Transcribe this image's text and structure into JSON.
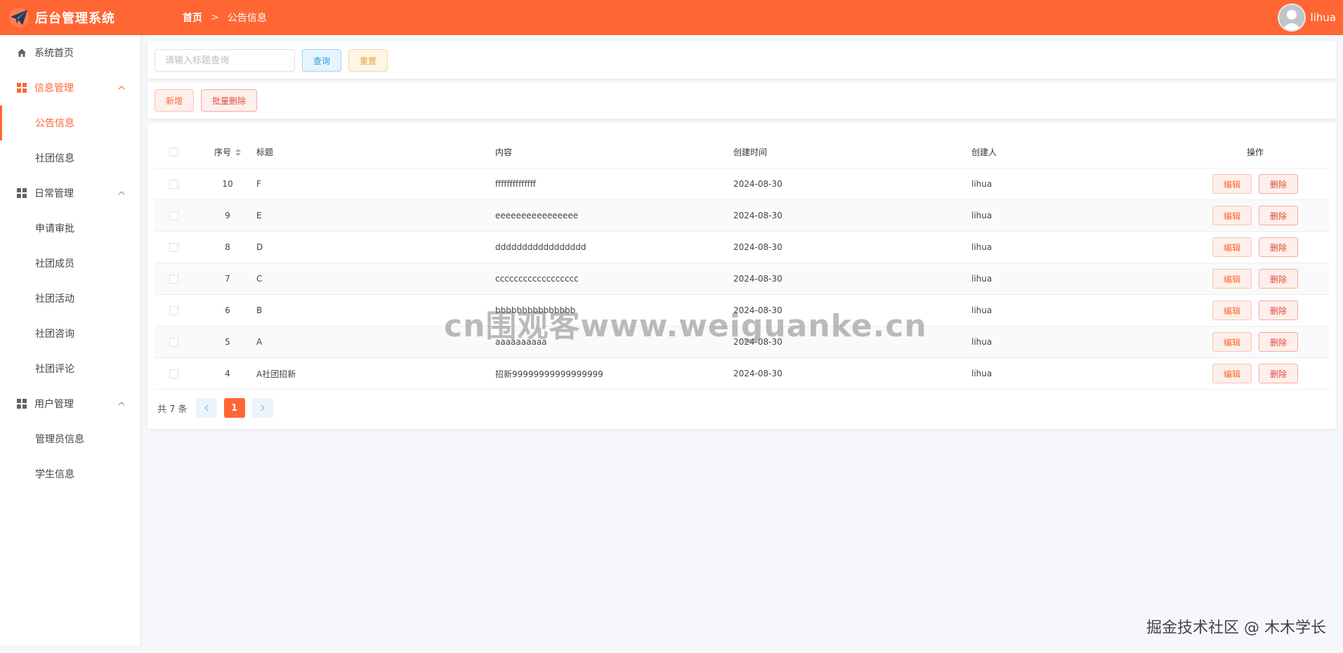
{
  "header": {
    "app_title": "后台管理系统",
    "breadcrumb_home": "首页",
    "breadcrumb_sep": ">",
    "breadcrumb_current": "公告信息",
    "user_name": "lihua"
  },
  "sidebar": {
    "home": "系统首页",
    "group_info": "信息管理",
    "info_items": [
      "公告信息",
      "社团信息"
    ],
    "group_daily": "日常管理",
    "daily_items": [
      "申请审批",
      "社团成员",
      "社团活动",
      "社团咨询",
      "社团评论"
    ],
    "group_user": "用户管理",
    "user_items": [
      "管理员信息",
      "学生信息"
    ]
  },
  "toolbar": {
    "search_placeholder": "请输入标题查询",
    "search_value": "",
    "query_label": "查询",
    "reset_label": "重置",
    "add_label": "新增",
    "batch_delete_label": "批量删除"
  },
  "table": {
    "columns": {
      "index": "序号",
      "title": "标题",
      "content": "内容",
      "created_at": "创建时间",
      "creator": "创建人",
      "ops": "操作"
    },
    "edit_label": "编辑",
    "delete_label": "删除",
    "rows": [
      {
        "index": "10",
        "title": "F",
        "content": "ffffffffffffff",
        "created_at": "2024-08-30",
        "creator": "lihua"
      },
      {
        "index": "9",
        "title": "E",
        "content": "eeeeeeeeeeeeeeee",
        "created_at": "2024-08-30",
        "creator": "lihua"
      },
      {
        "index": "8",
        "title": "D",
        "content": "ddddddddddddddddd",
        "created_at": "2024-08-30",
        "creator": "lihua"
      },
      {
        "index": "7",
        "title": "C",
        "content": "cccccccccccccccccc",
        "created_at": "2024-08-30",
        "creator": "lihua"
      },
      {
        "index": "6",
        "title": "B",
        "content": "bbbbbbbbbbbbbbb",
        "created_at": "2024-08-30",
        "creator": "lihua"
      },
      {
        "index": "5",
        "title": "A",
        "content": "aaaaaaaaaa",
        "created_at": "2024-08-30",
        "creator": "lihua"
      },
      {
        "index": "4",
        "title": "A社团招新",
        "content": "招新99999999999999999",
        "created_at": "2024-08-30",
        "creator": "lihua"
      }
    ]
  },
  "pagination": {
    "total_label": "共 7 条",
    "current_page": "1",
    "prev_icon": "chevron-left-icon",
    "next_icon": "chevron-right-icon"
  },
  "watermark": "cn围观客www.weiguanke.cn",
  "footer_mark": "掘金技术社区 @ 木木学长",
  "colors": {
    "brand": "#ff6633",
    "danger": "#e34a3a",
    "info": "#2b9ae0",
    "warning": "#e6a23c"
  }
}
